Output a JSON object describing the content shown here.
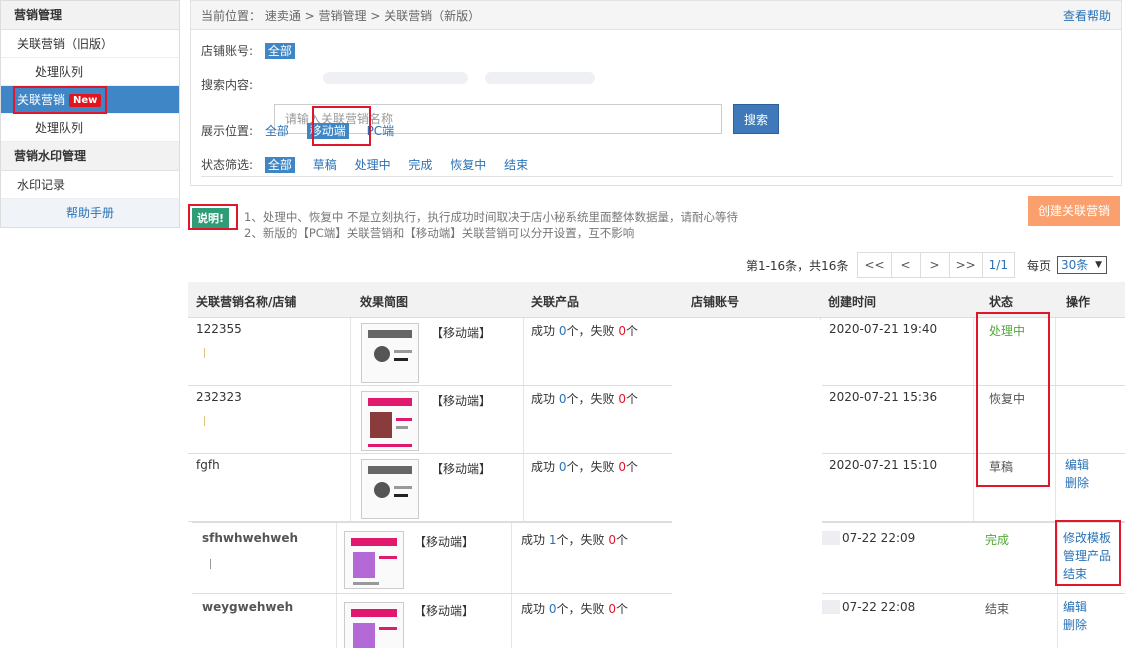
{
  "sidebar": {
    "section1": "营销管理",
    "item_old": "关联营销（旧版）",
    "item_queue1": "处理队列",
    "item_new": "关联营销",
    "new_badge": "New",
    "item_queue2": "处理队列",
    "section2": "营销水印管理",
    "item_watermark": "水印记录",
    "help": "帮助手册"
  },
  "breadcrumb": "当前位置： 速卖通 > 营销管理 > 关联营销（新版）",
  "help_link": "查看帮助",
  "filters": {
    "shop_label": "店铺账号:",
    "shop_all": "全部",
    "search_label": "搜索内容:",
    "search_placeholder": "请输入关联营销名称",
    "search_button": "搜索",
    "position_label": "展示位置:",
    "position_options": [
      "全部",
      "移动端",
      "PC端"
    ],
    "status_label": "状态筛选:",
    "status_options": [
      "全部",
      "草稿",
      "处理中",
      "完成",
      "恢复中",
      "结束"
    ]
  },
  "notice": {
    "tag": "说明!",
    "line1": "1、处理中、恢复中 不是立刻执行，执行成功时间取决于店小秘系统里面整体数据量，请耐心等待",
    "line2": "2、新版的【PC端】关联营销和【移动端】关联营销可以分开设置，互不影响"
  },
  "create_button": "创建关联营销",
  "pager": {
    "total": "第1-16条，共16条",
    "first": "<<",
    "prev": "<",
    "next": ">",
    "last": ">>",
    "page": "1/1",
    "per_label": "每页",
    "per_value": "30条"
  },
  "table": {
    "headers": [
      "关联营销名称/店铺",
      "效果简图",
      "关联产品",
      "店铺账号",
      "创建时间",
      "状态",
      "操作"
    ],
    "rows": [
      {
        "name": "122355",
        "platform": "【移动端】",
        "ok_prefix": "成功",
        "ok": "0",
        "ok_unit": "个，失败",
        "fail": "0",
        "fail_unit": "个",
        "time": "2020-07-21 19:40",
        "status": "处理中",
        "ops": []
      },
      {
        "name": "232323",
        "platform": "【移动端】",
        "ok_prefix": "成功",
        "ok": "0",
        "ok_unit": "个，失败",
        "fail": "0",
        "fail_unit": "个",
        "time": "2020-07-21 15:36",
        "status": "恢复中",
        "ops": []
      },
      {
        "name": "fgfh",
        "platform": "【移动端】",
        "ok_prefix": "成功",
        "ok": "0",
        "ok_unit": "个，失败",
        "fail": "0",
        "fail_unit": "个",
        "time": "2020-07-21 15:10",
        "status": "草稿",
        "ops": [
          "编辑",
          "删除"
        ]
      },
      {
        "name": "sfhwhwehweh",
        "platform": "【移动端】",
        "ok_prefix": "成功",
        "ok": "1",
        "ok_unit": "个，失败",
        "fail": "0",
        "fail_unit": "个",
        "time": "07-22 22:09",
        "status": "完成",
        "ops": [
          "修改模板",
          "管理产品",
          "结束"
        ]
      },
      {
        "name": "weygwehweh",
        "platform": "【移动端】",
        "ok_prefix": "成功",
        "ok": "0",
        "ok_unit": "个，失败",
        "fail": "0",
        "fail_unit": "个",
        "time": "07-22 22:08",
        "status": "结束",
        "ops": [
          "编辑",
          "删除"
        ]
      }
    ]
  },
  "colors": {
    "accent": "#3f86c6",
    "highlight": "#e0162c",
    "link": "#2a72b5",
    "success_status": "#52a83a",
    "create_button": "#f9a06e",
    "notice_tag": "#2d9c77"
  }
}
